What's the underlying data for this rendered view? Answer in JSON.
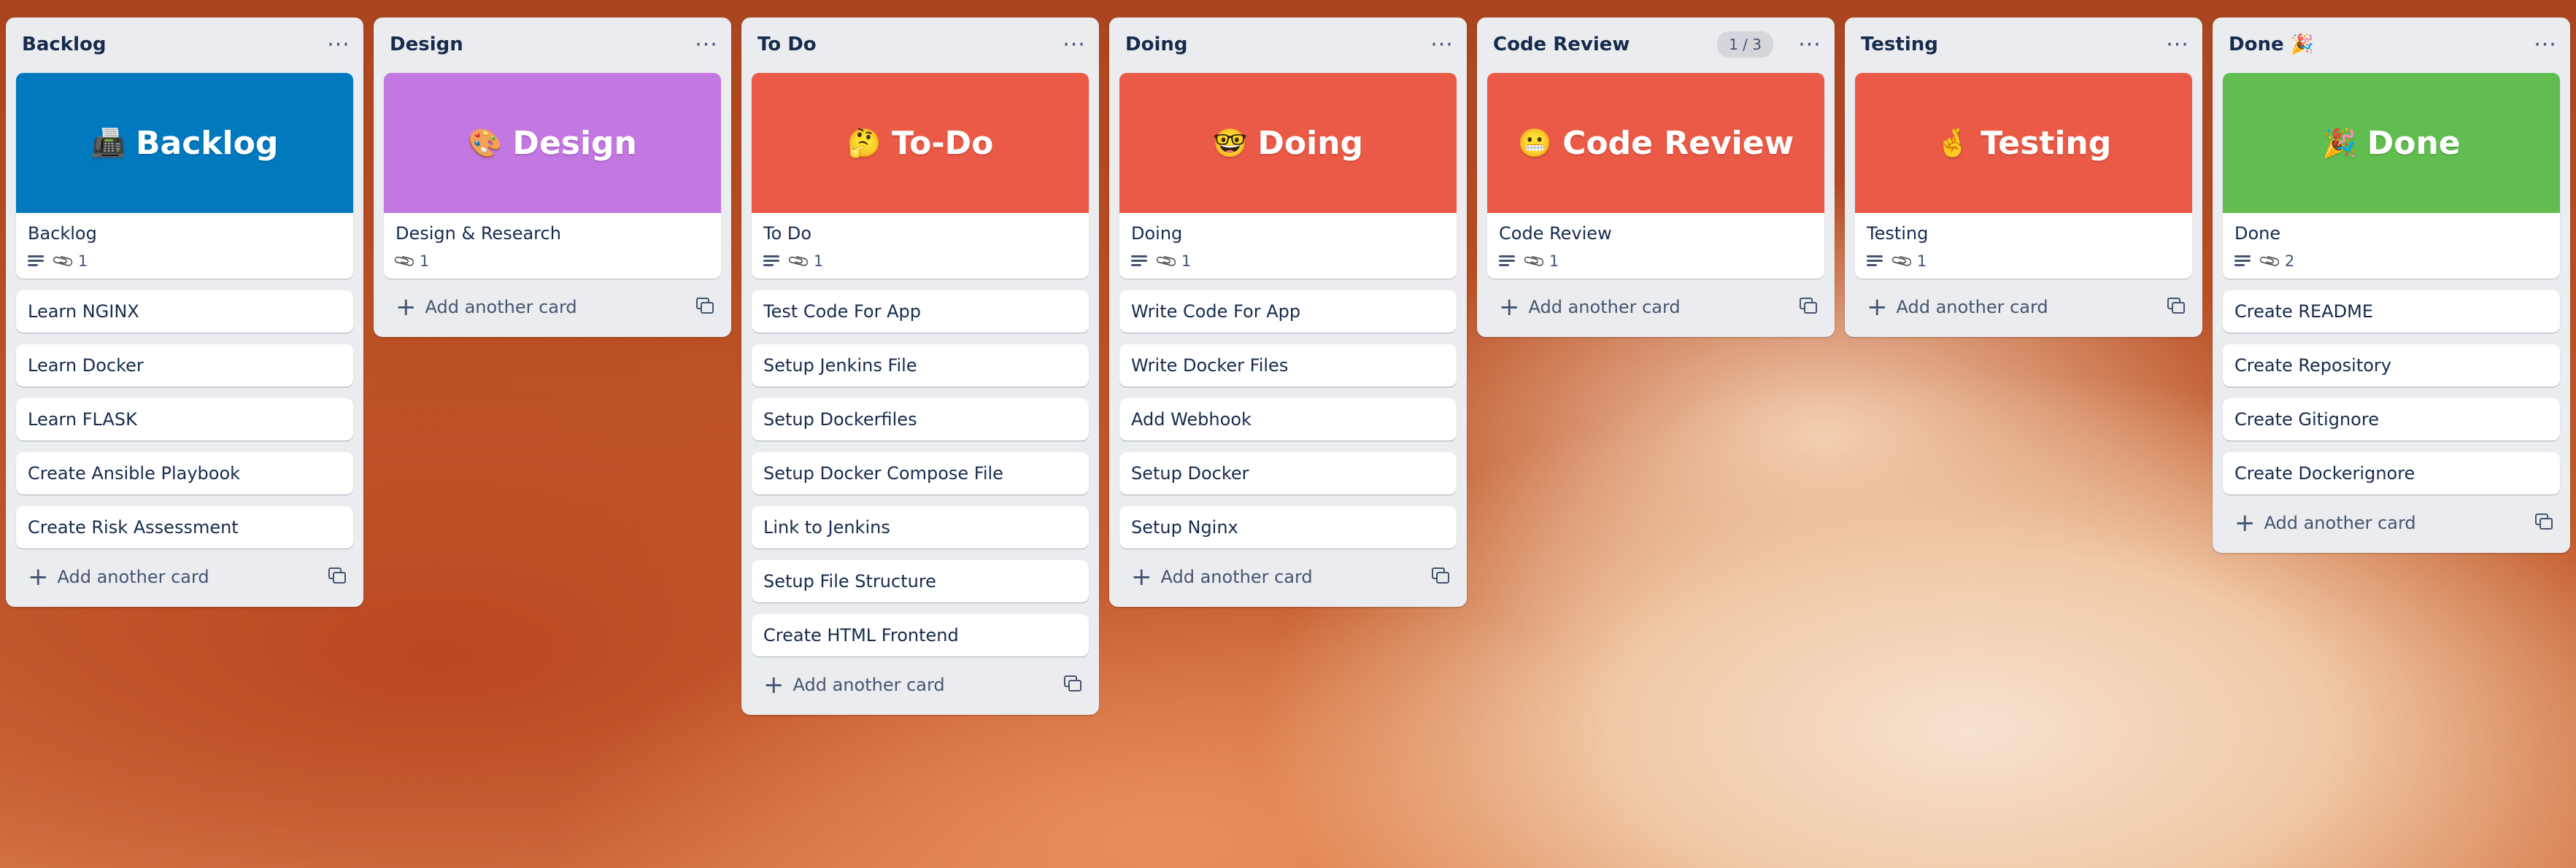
{
  "colors": {
    "blue": "#0079bf",
    "purple": "#c377e0",
    "red": "#eb5a46",
    "green": "#61bd4f"
  },
  "lists": [
    {
      "title": "Backlog",
      "cover": {
        "emoji": "📠",
        "text": "Backlog",
        "color": "#0079bf"
      },
      "cover_card": {
        "title": "Backlog",
        "has_description": true,
        "attachments": "1"
      },
      "cards": [
        "Learn NGINX",
        "Learn Docker",
        "Learn FLASK",
        "Create Ansible Playbook",
        "Create Risk Assessment"
      ],
      "add_label": "Add another card"
    },
    {
      "title": "Design",
      "cover": {
        "emoji": "🎨",
        "text": "Design",
        "color": "#c377e0"
      },
      "cover_card": {
        "title": "Design & Research",
        "has_description": false,
        "attachments": "1"
      },
      "cards": [],
      "add_label": "Add another card"
    },
    {
      "title": "To Do",
      "cover": {
        "emoji": "🤔",
        "text": "To-Do",
        "color": "#eb5a46"
      },
      "cover_card": {
        "title": "To Do",
        "has_description": true,
        "attachments": "1"
      },
      "cards": [
        "Test Code For App",
        "Setup Jenkins File",
        "Setup Dockerfiles",
        "Setup Docker Compose File",
        "Link to Jenkins",
        "Setup File Structure",
        "Create HTML Frontend"
      ],
      "add_label": "Add another card"
    },
    {
      "title": "Doing",
      "cover": {
        "emoji": "🤓",
        "text": "Doing",
        "color": "#eb5a46"
      },
      "cover_card": {
        "title": "Doing",
        "has_description": true,
        "attachments": "1"
      },
      "cards": [
        "Write Code For App",
        "Write Docker Files",
        "Add Webhook",
        "Setup Docker",
        "Setup Nginx"
      ],
      "add_label": "Add another card"
    },
    {
      "title": "Code Review",
      "count": "1 / 3",
      "cover": {
        "emoji": "😬",
        "text": "Code Review",
        "color": "#eb5a46"
      },
      "cover_card": {
        "title": "Code Review",
        "has_description": true,
        "attachments": "1"
      },
      "cards": [],
      "add_label": "Add another card"
    },
    {
      "title": "Testing",
      "cover": {
        "emoji": "🤞",
        "text": "Testing",
        "color": "#eb5a46"
      },
      "cover_card": {
        "title": "Testing",
        "has_description": true,
        "attachments": "1"
      },
      "cards": [],
      "add_label": "Add another card"
    },
    {
      "title": "Done 🎉",
      "cover": {
        "emoji": "🎉",
        "text": "Done",
        "color": "#61bd4f"
      },
      "cover_card": {
        "title": "Done",
        "has_description": true,
        "attachments": "2"
      },
      "cards": [
        "Create README",
        "Create Repository",
        "Create Gitignore",
        "Create Dockerignore"
      ],
      "add_label": "Add another card"
    }
  ],
  "icons": {
    "menu": "more-horizontal-icon",
    "description": "description-icon",
    "attachment": "paperclip-icon",
    "add": "plus-icon",
    "template": "card-template-icon"
  }
}
